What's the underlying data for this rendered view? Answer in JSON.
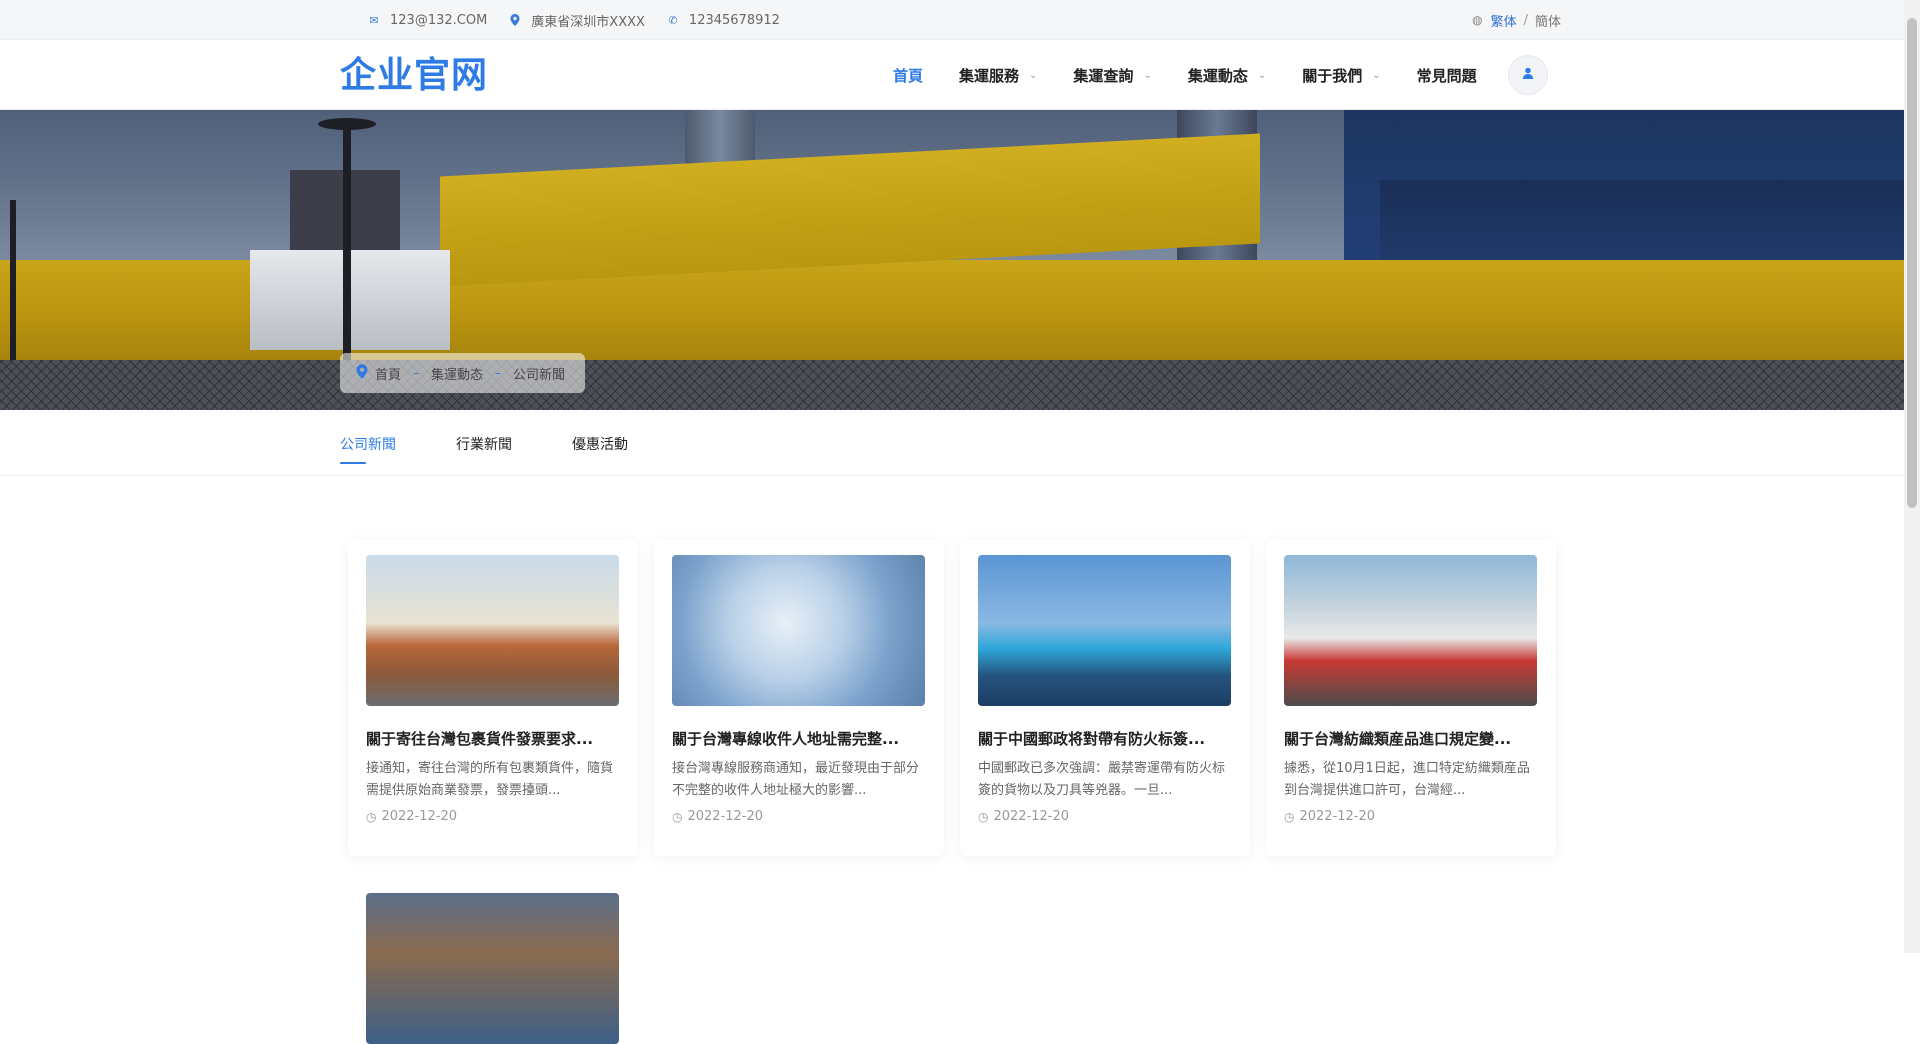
{
  "topbar": {
    "email": "123@132.COM",
    "address": "廣東省深圳市XXXX",
    "phone": "12345678912",
    "lang_traditional": "繁体",
    "lang_sep": "/",
    "lang_simplified": "簡体"
  },
  "header": {
    "logo": "企业官网",
    "nav": [
      {
        "label": "首頁"
      },
      {
        "label": "集運服務"
      },
      {
        "label": "集運查詢"
      },
      {
        "label": "集運動态"
      },
      {
        "label": "關于我們"
      },
      {
        "label": "常見問題"
      }
    ]
  },
  "breadcrumb": [
    "首頁",
    "集運動态",
    "公司新聞"
  ],
  "tabs": [
    "公司新聞",
    "行業新聞",
    "優惠活動"
  ],
  "cards": [
    {
      "title": "關于寄往台灣包裹貨件發票要求...",
      "desc": "接通知，寄往台灣的所有包裹類貨件，隨貨需提供原始商業發票，發票擡頭...",
      "date": "2022-12-20"
    },
    {
      "title": "關于台灣專線收件人地址需完整...",
      "desc": "接台灣專線服務商通知，最近發現由于部分不完整的收件人地址極大的影響...",
      "date": "2022-12-20"
    },
    {
      "title": "關于中國郵政将對帶有防火标簽...",
      "desc": "中國郵政已多次強調：嚴禁寄運帶有防火标簽的貨物以及刀具等兇器。一旦...",
      "date": "2022-12-20"
    },
    {
      "title": "關于台灣紡織類産品進口規定變...",
      "desc": "據悉，從10月1日起，進口特定紡織類産品到台灣提供進口許可，台灣經...",
      "date": "2022-12-20"
    }
  ],
  "colors": {
    "accent": "#2f7be5"
  }
}
